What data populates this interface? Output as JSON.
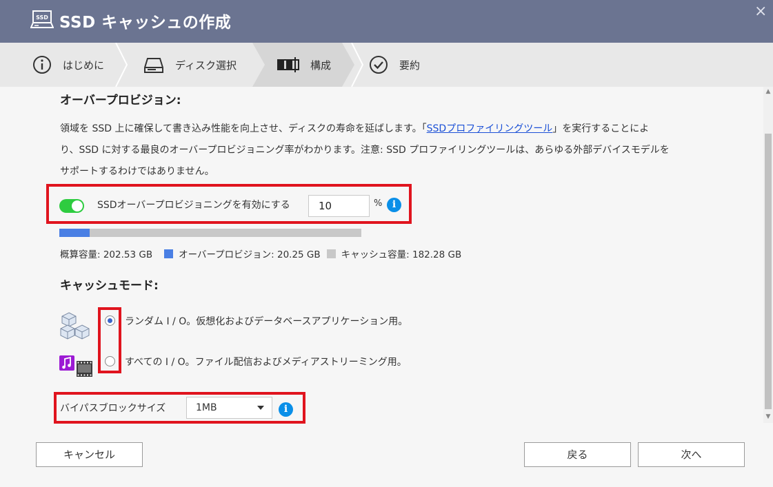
{
  "window": {
    "title": "SSD キャッシュの作成",
    "title_icon": "ssd-drive-icon",
    "close_glyph": "×"
  },
  "steps": [
    {
      "label": "はじめに",
      "icon": "info-circle-icon"
    },
    {
      "label": "ディスク選択",
      "icon": "disk-drive-icon"
    },
    {
      "label": "構成",
      "icon": "configure-icon",
      "active": true
    },
    {
      "label": "要約",
      "icon": "check-circle-icon"
    }
  ],
  "overprovision": {
    "heading": "オーバープロビジョン:",
    "desc_part1": "領域を SSD 上に確保して書き込み性能を向上させ、ディスクの寿命を延ばします。「",
    "desc_link": "SSDプロファイリングツール",
    "desc_part2": "」を実行することによ",
    "desc_line2": "り、SSD に対する最良のオーバープロビジョニング率がわかります。注意: SSD プロファイリングツールは、あらゆる外部デバイスモデルを",
    "desc_line3": "サポートするわけではありません。",
    "toggle_label": "SSDオーバープロビジョニングを有効にする",
    "toggle_on": true,
    "percent_value": "10",
    "percent_unit": "%",
    "info_glyph": "i",
    "usage_fraction": 0.1
  },
  "capacity": {
    "total": "概算容量: 202.53 GB",
    "overprovision": "オーバープロビジョン: 20.25 GB",
    "cache": "キャッシュ容量: 182.28 GB",
    "overprovision_color": "#4a7fe4",
    "cache_color": "#c8c8c8"
  },
  "cache_mode": {
    "heading": "キャッシュモード:",
    "options": [
      {
        "label": "ランダム I / O。仮想化およびデータベースアプリケーション用。",
        "icon": "cubes-icon",
        "selected": true
      },
      {
        "label": "すべての I / O。ファイル配信およびメディアストリーミング用。",
        "icon": "media-icon",
        "selected": false
      }
    ]
  },
  "bypass": {
    "label": "バイパスブロックサイズ",
    "value": "1MB"
  },
  "buttons": {
    "cancel": "キャンセル",
    "back": "戻る",
    "next": "次へ"
  },
  "colors": {
    "titlebar": "#6b7491",
    "highlight": "#e0141e",
    "toggle_on": "#2ecc40",
    "info": "#0a8fe8",
    "link": "#1a4fd6"
  }
}
